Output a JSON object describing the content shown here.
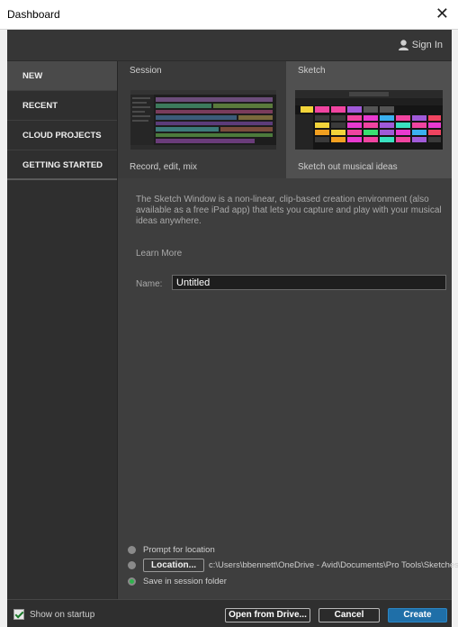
{
  "window": {
    "title": "Dashboard",
    "close_glyph": "✕"
  },
  "topbar": {
    "signin_label": "Sign In",
    "signin_icon": "user-icon"
  },
  "sidebar": {
    "items": [
      {
        "label": "NEW",
        "active": true
      },
      {
        "label": "RECENT"
      },
      {
        "label": "CLOUD PROJECTS"
      },
      {
        "label": "GETTING STARTED"
      }
    ]
  },
  "cards": {
    "session": {
      "title": "Session",
      "caption": "Record, edit, mix"
    },
    "sketch": {
      "title": "Sketch",
      "caption": "Sketch out musical ideas",
      "selected": true
    }
  },
  "description": "The Sketch Window is a non-linear, clip-based creation environment (also available as a free iPad app) that lets you capture and play with your musical ideas anywhere.",
  "learn_more": "Learn More",
  "name_field": {
    "label": "Name:",
    "value": "Untitled"
  },
  "location_options": {
    "prompt": "Prompt for location",
    "location_button": "Location...",
    "location_path": "c:\\Users\\bbennett\\OneDrive - Avid\\Documents\\Pro Tools\\Sketches\\",
    "save_in_session": "Save in session folder",
    "selected": "save_in_session"
  },
  "footer": {
    "show_on_startup": "Show on startup",
    "show_on_startup_checked": true,
    "open_from_drive": "Open from Drive...",
    "cancel": "Cancel",
    "create": "Create"
  },
  "colors": {
    "accent": "#1f6fa8",
    "radio_selected": "#2fb24c"
  }
}
